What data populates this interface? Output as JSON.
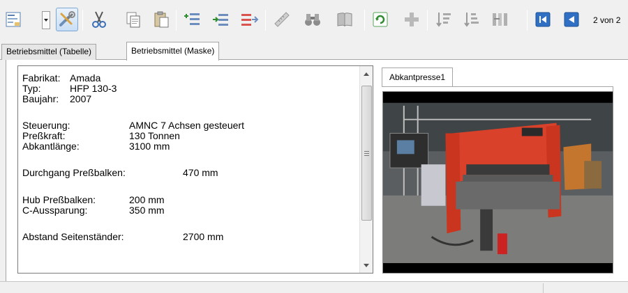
{
  "toolbar": {
    "buttons": [
      {
        "name": "form-view-icon",
        "active": false
      },
      {
        "name": "tools-icon",
        "active": true
      },
      {
        "name": "cut-icon",
        "active": false
      },
      {
        "name": "copy-icon",
        "active": false
      },
      {
        "name": "paste-icon",
        "active": false
      },
      {
        "name": "insert-record-icon",
        "active": false
      },
      {
        "name": "insert-after-icon",
        "active": false
      },
      {
        "name": "move-record-icon",
        "active": false
      },
      {
        "name": "ruler-icon",
        "active": false
      },
      {
        "name": "binoculars-icon",
        "active": false
      },
      {
        "name": "book-icon",
        "active": false
      },
      {
        "name": "refresh-icon",
        "active": false
      },
      {
        "name": "add-icon",
        "active": false
      },
      {
        "name": "sort-ascending-icon",
        "active": false
      },
      {
        "name": "sort-descending-icon",
        "active": false
      },
      {
        "name": "sort-columns-icon",
        "active": false
      },
      {
        "name": "first-record-icon",
        "active": false
      },
      {
        "name": "previous-record-icon",
        "active": false
      }
    ],
    "page_counter": "2 von 2"
  },
  "tabs": [
    {
      "label": "Betriebsmittel (Tabelle)",
      "selected": false
    },
    {
      "label": "Betriebsmittel (Maske)",
      "selected": true
    }
  ],
  "details": {
    "fabrikat_label": "Fabrikat:",
    "fabrikat_value": "Amada",
    "typ_label": "Typ:",
    "typ_value": "HFP 130-3",
    "baujahr_label": "Baujahr:",
    "baujahr_value": "2007",
    "steuerung_label": "Steuerung:",
    "steuerung_value": "AMNC 7 Achsen gesteuert",
    "presskraft_label": "Preßkraft:",
    "presskraft_value": "130 Tonnen",
    "abkantlaenge_label": "Abkantlänge:",
    "abkantlaenge_value": "3100 mm",
    "durchgang_label": "Durchgang Preßbalken:",
    "durchgang_value": "470 mm",
    "hub_label": "Hub Preßbalken:",
    "hub_value": "200 mm",
    "c_aussparung_label": "C-Aussparung:",
    "c_aussparung_value": "350 mm",
    "abstand_label": "Abstand Seitenständer:",
    "abstand_value": "2700 mm"
  },
  "image_panel": {
    "tab_label": "Abkantpresse1",
    "photo_name": "Amada press brake photo",
    "colors": {
      "machine_red": "#d9412b",
      "machine_dark": "#3a3a3a",
      "floor": "#6e6e6e",
      "background": "#000000"
    }
  }
}
